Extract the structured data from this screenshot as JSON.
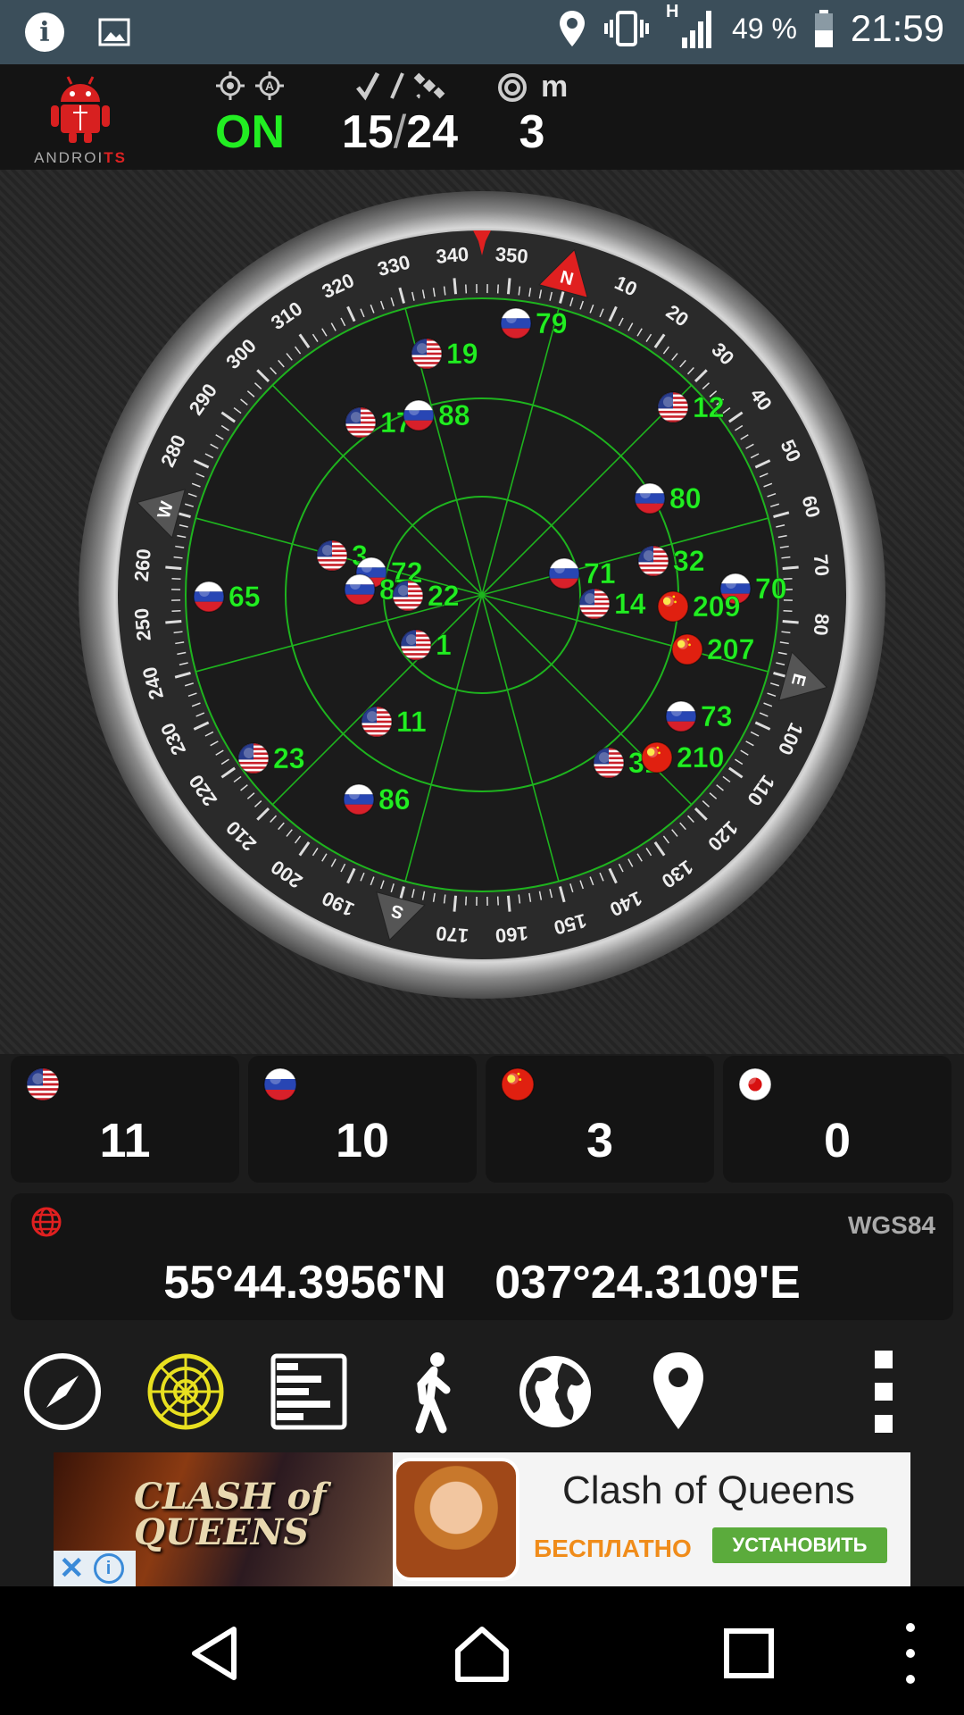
{
  "status_bar": {
    "battery_percent": "49 %",
    "time": "21:59",
    "network_type": "H"
  },
  "header": {
    "logo_text_a": "ANDROI",
    "logo_text_b": "TS",
    "gps_status": "ON",
    "satellites_used": "15",
    "satellites_slash": "/",
    "satellites_visible": "24",
    "accuracy": "3",
    "accuracy_unit": "m"
  },
  "compass": {
    "cardinals": [
      "N",
      "E",
      "S",
      "W"
    ],
    "heading_deg": 15,
    "degree_labels": [
      "10",
      "20",
      "30",
      "40",
      "50",
      "60",
      "70",
      "80",
      "100",
      "110",
      "120",
      "130",
      "140",
      "150",
      "160",
      "170",
      "190",
      "200",
      "210",
      "220",
      "230",
      "240",
      "250",
      "260",
      "280",
      "290",
      "300",
      "310",
      "320",
      "330",
      "340",
      "350"
    ]
  },
  "satellites": [
    {
      "id": "79",
      "flag": "russia"
    },
    {
      "id": "19",
      "flag": "usa"
    },
    {
      "id": "12",
      "flag": "usa"
    },
    {
      "id": "17",
      "flag": "usa"
    },
    {
      "id": "88",
      "flag": "russia"
    },
    {
      "id": "80",
      "flag": "russia"
    },
    {
      "id": "3",
      "flag": "usa"
    },
    {
      "id": "72",
      "flag": "russia"
    },
    {
      "id": "87",
      "flag": "russia"
    },
    {
      "id": "22",
      "flag": "usa"
    },
    {
      "id": "65",
      "flag": "russia"
    },
    {
      "id": "71",
      "flag": "russia"
    },
    {
      "id": "32",
      "flag": "usa"
    },
    {
      "id": "70",
      "flag": "russia"
    },
    {
      "id": "14",
      "flag": "usa"
    },
    {
      "id": "209",
      "flag": "china"
    },
    {
      "id": "207",
      "flag": "china"
    },
    {
      "id": "1",
      "flag": "usa"
    },
    {
      "id": "11",
      "flag": "usa"
    },
    {
      "id": "73",
      "flag": "russia"
    },
    {
      "id": "23",
      "flag": "usa"
    },
    {
      "id": "31",
      "flag": "usa"
    },
    {
      "id": "210",
      "flag": "china"
    },
    {
      "id": "86",
      "flag": "russia"
    }
  ],
  "constellation_counts": [
    {
      "system": "GPS",
      "flag": "usa",
      "count": "11"
    },
    {
      "system": "GLONASS",
      "flag": "russia",
      "count": "10"
    },
    {
      "system": "BeiDou",
      "flag": "china",
      "count": "3"
    },
    {
      "system": "QZSS",
      "flag": "japan",
      "count": "0"
    }
  ],
  "location": {
    "datum": "WGS84",
    "latitude": "55°44.3956'N",
    "longitude": "037°24.3109'E"
  },
  "toolbar": {
    "buttons": [
      "compass-icon",
      "radar-icon",
      "signal-bars-icon",
      "walking-icon",
      "globe-icon",
      "map-pin-icon",
      "more-menu-icon"
    ],
    "active": "radar-icon"
  },
  "ad": {
    "art_title_1": "CLASH of",
    "art_title_2": "QUEENS",
    "title": "Clash of Queens",
    "free_label": "БЕСПЛАТНО",
    "install_label": "УСТАНОВИТЬ"
  },
  "colors": {
    "green": "#22ee22",
    "status_bar": "#3b4e5a",
    "accent_red": "#e02020",
    "ad_green": "#5bab3c",
    "ad_orange": "#f08c1a"
  }
}
